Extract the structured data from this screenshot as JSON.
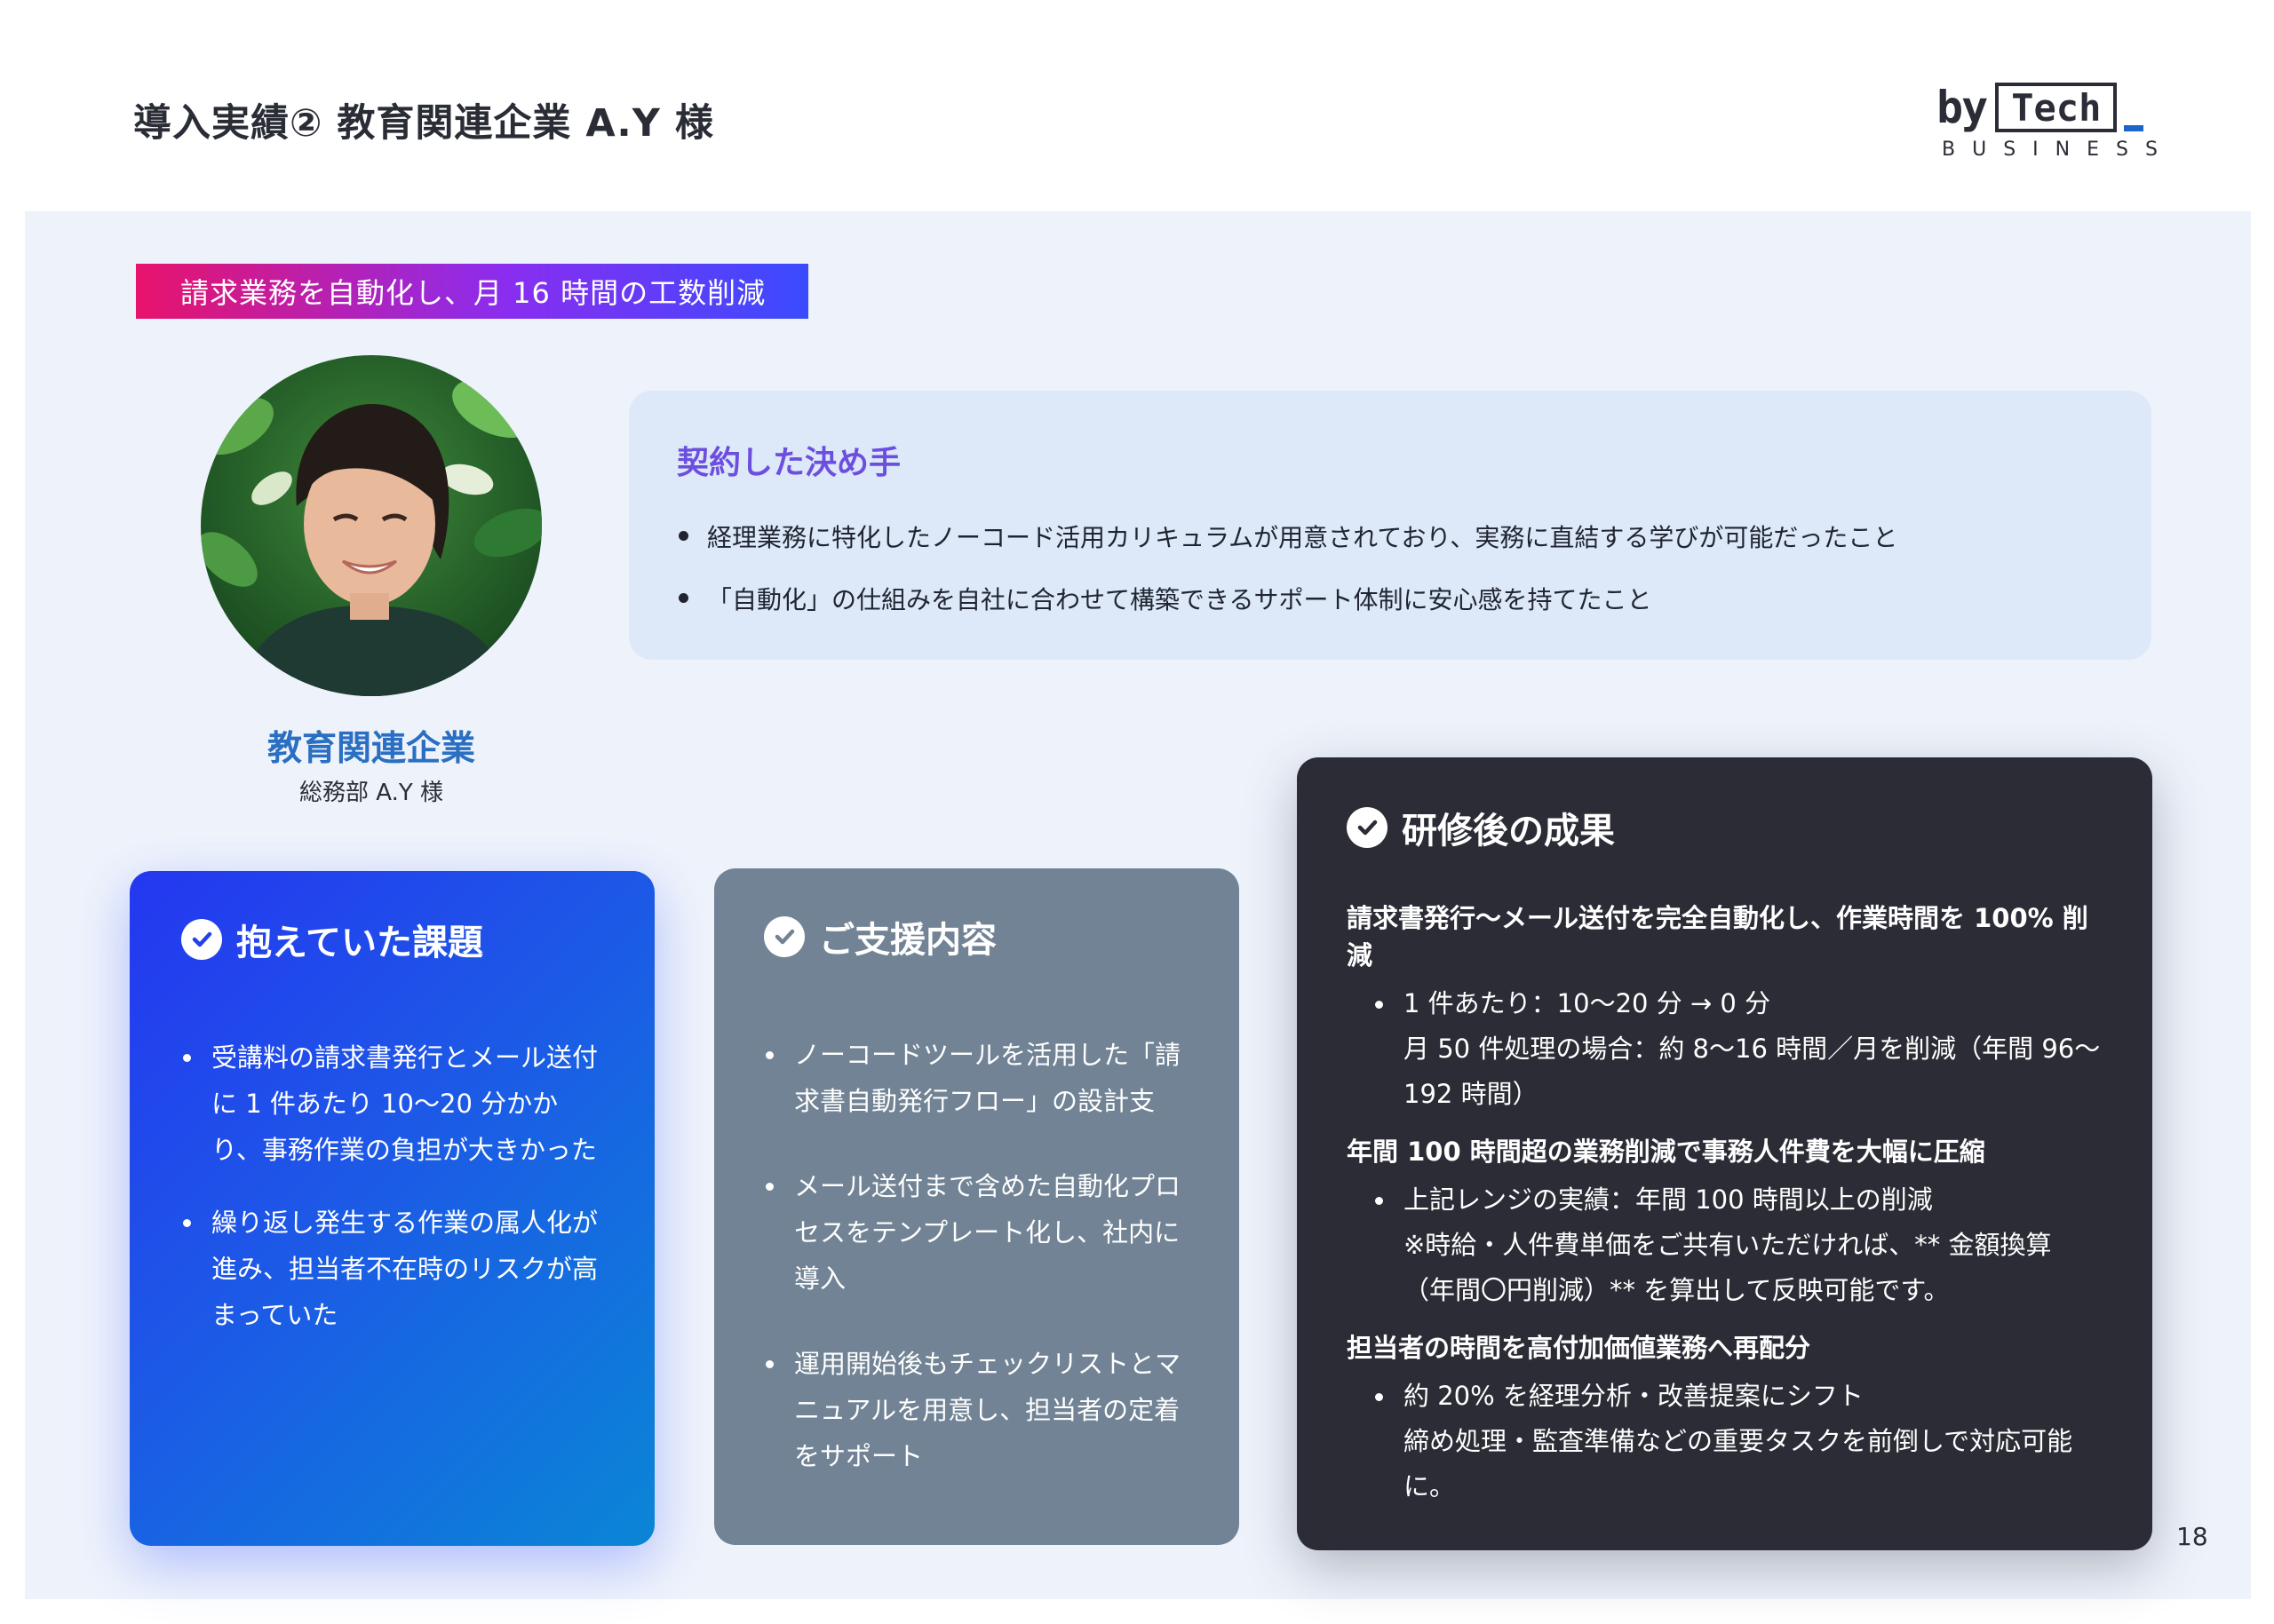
{
  "header": {
    "title": "導入実績② 教育関連企業 A.Y 様",
    "logo_main": "by",
    "logo_box": "Tech",
    "logo_sub": "BUSINESS"
  },
  "headline": "請求業務を自動化し、月 16 時間の工数削減",
  "profile": {
    "company": "教育関連企業",
    "person": "総務部 A.Y 様"
  },
  "decision": {
    "title": "契約した決め手",
    "items": [
      "経理業務に特化したノーコード活用カリキュラムが用意されており、実務に直結する学びが可能だったこと",
      "「自動化」の仕組みを自社に合わせて構築できるサポート体制に安心感を持てたこと"
    ]
  },
  "issues": {
    "title": "抱えていた課題",
    "items": [
      "受講料の請求書発行とメール送付に 1 件あたり 10〜20 分かかり、事務作業の負担が大きかった",
      "繰り返し発生する作業の属人化が進み、担当者不在時のリスクが高まっていた"
    ]
  },
  "support": {
    "title": "ご支援内容",
    "items": [
      "ノーコードツールを活用した「請求書自動発行フロー」の設計支",
      "メール送付まで含めた自動化プロセスをテンプレート化し、社内に導入",
      "運用開始後もチェックリストとマニュアルを用意し、担当者の定着をサポート"
    ]
  },
  "results": {
    "title": "研修後の成果",
    "sections": [
      {
        "title": "請求書発行〜メール送付を完全自動化し、作業時間を 100% 削減",
        "line1": "1 件あたり：10〜20 分 → 0 分",
        "line2": "月 50 件処理の場合：約 8〜16 時間／月を削減（年間 96〜192 時間）"
      },
      {
        "title": "年間 100 時間超の業務削減で事務人件費を大幅に圧縮",
        "line1": "上記レンジの実績：年間 100 時間以上の削減",
        "line2": "※時給・人件費単価をご共有いただければ、** 金額換算（年間〇円削減）** を算出して反映可能です。"
      },
      {
        "title": "担当者の時間を高付加価値業務へ再配分",
        "line1": "約 20% を経理分析・改善提案にシフト",
        "line2": "締め処理・監査準備などの重要タスクを前倒しで対応可能に。"
      }
    ]
  },
  "page_number": "18",
  "colors": {
    "accent_blue": "#1e55e8",
    "accent_purple": "#6d4fe0",
    "company_blue": "#2a6fc2",
    "support_gray": "#718394",
    "result_dark": "#2b2c35"
  }
}
